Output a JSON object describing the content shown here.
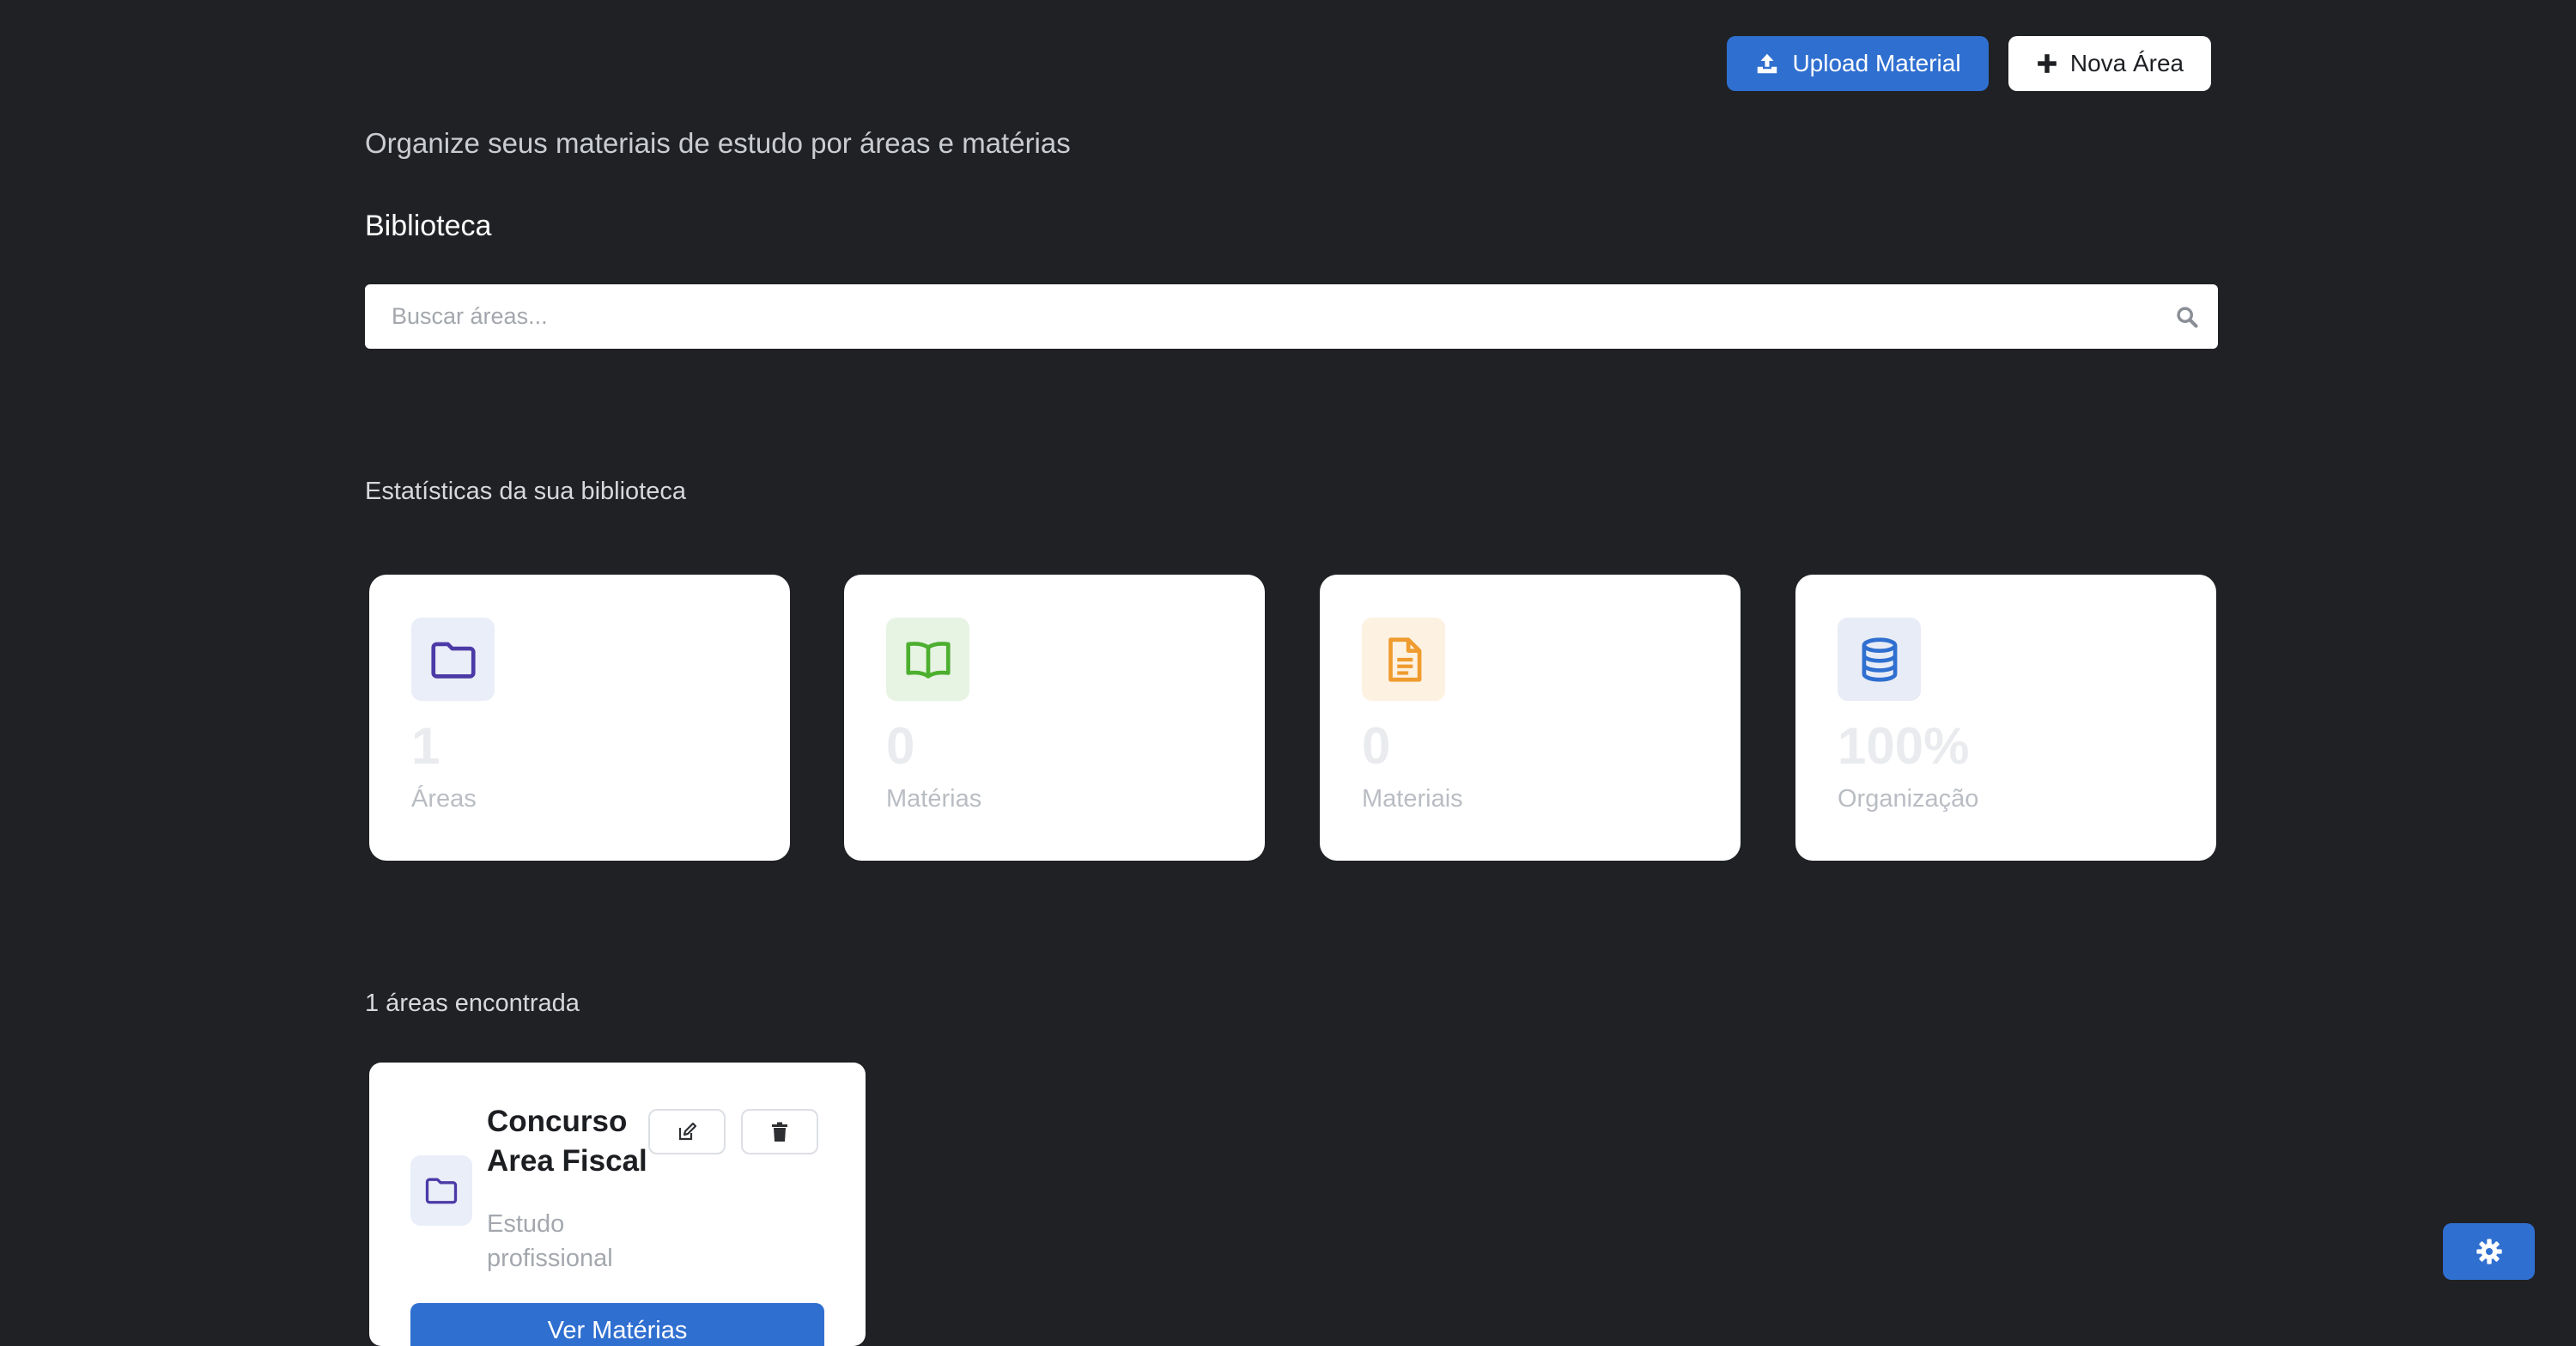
{
  "header": {
    "upload_label": "Upload Material",
    "new_area_label": "Nova Área"
  },
  "intro": {
    "subtitle": "Organize seus materiais de estudo por áreas e matérias",
    "title": "Biblioteca"
  },
  "search": {
    "placeholder": "Buscar áreas..."
  },
  "stats": {
    "label": "Estatísticas da sua biblioteca",
    "items": [
      {
        "value": "1",
        "label": "Áreas",
        "icon": "folder-icon",
        "color": "#4b3aa6",
        "bg": "#e9eef8"
      },
      {
        "value": "0",
        "label": "Matérias",
        "icon": "book-icon",
        "color": "#4caf2f",
        "bg": "#e7f3e3"
      },
      {
        "value": "0",
        "label": "Materiais",
        "icon": "document-icon",
        "color": "#ef9b2f",
        "bg": "#fdf1e1"
      },
      {
        "value": "100%",
        "label": "Organização",
        "icon": "database-icon",
        "color": "#2f6fd0",
        "bg": "#e8ecf6"
      }
    ]
  },
  "areas": {
    "count_label": "1 áreas encontrada",
    "items": [
      {
        "title": "Concurso Area Fiscal",
        "description": "Estudo profissional",
        "button_label": "Ver Matérias"
      }
    ]
  },
  "colors": {
    "background": "#202124",
    "accent": "#2f6fd0"
  }
}
